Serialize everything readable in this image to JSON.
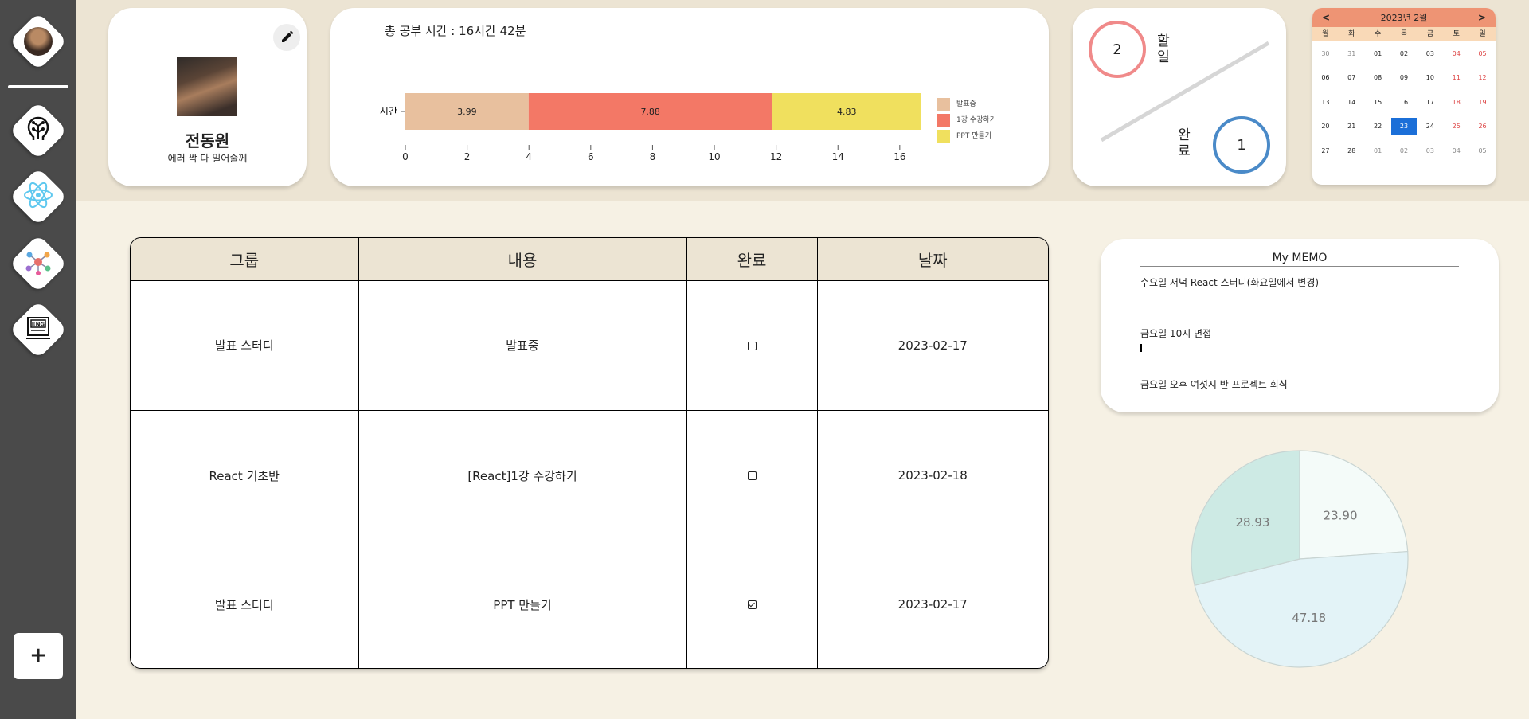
{
  "sidebar": {
    "items": [
      {
        "name": "profile",
        "icon": "avatar-icon"
      },
      {
        "name": "study-timer",
        "icon": "brain-circuit-icon"
      },
      {
        "name": "react",
        "icon": "react-atom-icon"
      },
      {
        "name": "network",
        "icon": "network-graph-icon"
      },
      {
        "name": "english",
        "icon": "eng-book-icon"
      }
    ],
    "add_label": "+"
  },
  "profile": {
    "name": "전동원",
    "description": "에러 싹 다 밀어줄께"
  },
  "study_time": {
    "title": "총 공부 시간 : 16시간 42분"
  },
  "chart_data": [
    {
      "type": "bar",
      "orientation": "horizontal",
      "stacked": true,
      "categories": [
        "시간"
      ],
      "series": [
        {
          "name": "발표중",
          "values": [
            3.99
          ],
          "color": "#e8c09e"
        },
        {
          "name": "1강 수강하기",
          "values": [
            7.88
          ],
          "color": "#f37866"
        },
        {
          "name": "PPT 만들기",
          "values": [
            4.83
          ],
          "color": "#f0e05e"
        }
      ],
      "xticks": [
        0,
        2,
        4,
        6,
        8,
        10,
        12,
        14,
        16
      ],
      "xlim": [
        0,
        16.7
      ],
      "legend": "right"
    },
    {
      "type": "pie",
      "values": [
        23.9,
        47.18,
        28.93
      ],
      "labels": [
        "23.90",
        "47.18",
        "28.93"
      ],
      "colors": [
        "#f4fbf9",
        "#e3f3f7",
        "#cdeae4"
      ]
    }
  ],
  "counts": {
    "todo_label": "할일",
    "todo_count": "2",
    "done_label": "완료",
    "done_count": "1"
  },
  "calendar": {
    "prev": "<",
    "next": ">",
    "title": "2023년 2월",
    "weekdays": [
      "월",
      "화",
      "수",
      "목",
      "금",
      "토",
      "일"
    ],
    "days": [
      "30",
      "31",
      "01",
      "02",
      "03",
      "04",
      "05",
      "06",
      "07",
      "08",
      "09",
      "10",
      "11",
      "12",
      "13",
      "14",
      "15",
      "16",
      "17",
      "18",
      "19",
      "20",
      "21",
      "22",
      "23",
      "24",
      "25",
      "26",
      "27",
      "28",
      "01",
      "02",
      "03",
      "04",
      "05"
    ],
    "today": "23"
  },
  "table": {
    "headers": [
      "그룹",
      "내용",
      "완료",
      "날짜"
    ],
    "rows": [
      {
        "group": "발표 스터디",
        "content": "발표중",
        "done": false,
        "date": "2023-02-17"
      },
      {
        "group": "React 기초반",
        "content": "[React]1강 수강하기",
        "done": false,
        "date": "2023-02-18"
      },
      {
        "group": "발표 스터디",
        "content": "PPT 만들기",
        "done": true,
        "date": "2023-02-17"
      }
    ]
  },
  "memo": {
    "title": "My MEMO",
    "lines": [
      "수요일 저녁 React 스터디(화요일에서 변경)",
      "금요일 10시  면접",
      "금요일 오후 여섯시 반 프로젝트 회식"
    ],
    "separator": "- - - - - - - - - - - - - - - - - - - - - - - - -"
  }
}
